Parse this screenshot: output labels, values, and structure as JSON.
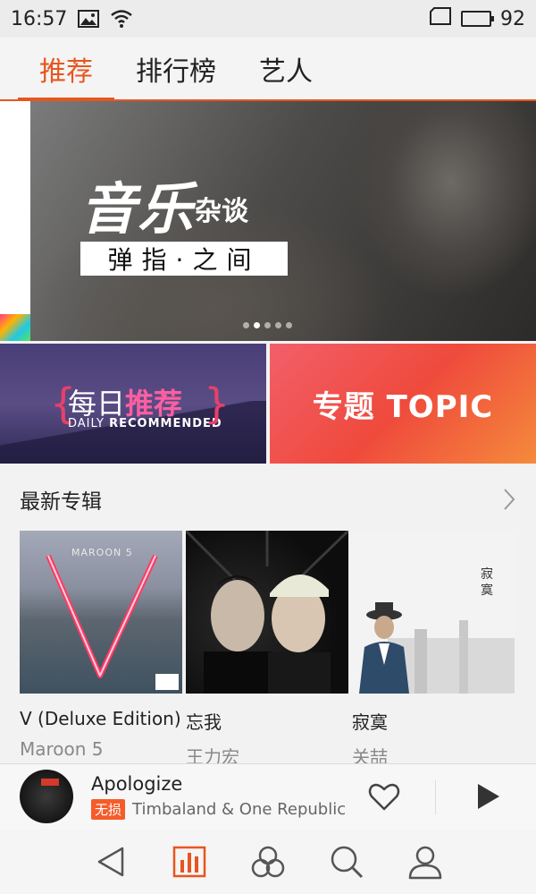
{
  "status_bar": {
    "time": "16:57",
    "battery": "92",
    "battery_level": 0.92
  },
  "tabs": [
    {
      "label": "推荐",
      "active": true
    },
    {
      "label": "排行榜",
      "active": false
    },
    {
      "label": "艺人",
      "active": false
    }
  ],
  "banner": {
    "title": "音乐",
    "subtitle": "杂谈",
    "tagline": "弹指·之间",
    "page_count": 5,
    "current_page": 2
  },
  "promos": {
    "daily": {
      "cn_prefix": "每日",
      "cn_highlight": "推荐",
      "en_prefix": "DAILY ",
      "en_highlight": "RECOMMENDED"
    },
    "topic": {
      "label": "专题 TOPIC"
    }
  },
  "section": {
    "title": "最新专辑",
    "albums": [
      {
        "name": "V (Deluxe Edition)",
        "artist": "Maroon 5",
        "cover_band": "MAROON 5"
      },
      {
        "name": "忘我",
        "artist": "王力宏"
      },
      {
        "name": "寂寞",
        "artist": "关喆",
        "cover_title": "寂寞"
      }
    ]
  },
  "player": {
    "song": "Apologize",
    "quality": "无损",
    "artist": "Timbaland & One Republic"
  },
  "colors": {
    "accent": "#e8551e",
    "quality_badge": "#f55c2a"
  },
  "icons": {
    "status_left": [
      "image-icon",
      "wifi-icon"
    ],
    "status_right": [
      "sim-card-icon",
      "battery-icon"
    ],
    "bottom_nav": [
      "back-icon",
      "chart-icon",
      "discover-icon",
      "search-icon",
      "profile-icon"
    ],
    "player": [
      "heart-icon",
      "play-icon"
    ]
  }
}
